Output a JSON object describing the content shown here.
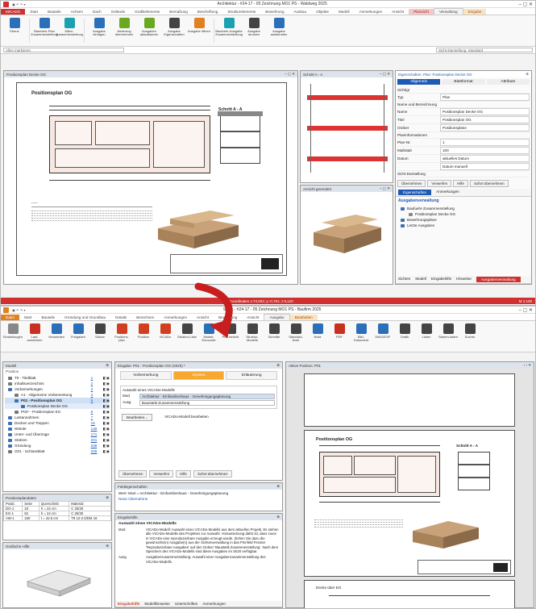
{
  "top": {
    "title": "Architektur - #24-17 - 05 Zeichnung MO1 PS - Waldweg 2025",
    "tabs": [
      "MICADO",
      "Start",
      "Bauteile",
      "Achsen",
      "Dach",
      "Gelände",
      "Grafikelemente",
      "Bemaßung",
      "Beschriftung",
      "Strukturelemente",
      "Bewehrung",
      "Ausbau",
      "Objekte",
      "Modell",
      "Anmerkungen",
      "Ansicht",
      "Plansicht",
      "Verwaltung",
      "Eingabe"
    ],
    "ribbon": [
      {
        "label": "Ebene"
      },
      {
        "label": "Baufuehr-Plan Zusammenstellung"
      },
      {
        "label": "Mikro-Zusammenstellung"
      },
      {
        "label": "Ausgabe einfügen"
      },
      {
        "label": "Änderung übernehmen"
      },
      {
        "label": "Ausgaben aktualisieren"
      },
      {
        "label": "Ausgabe Eigenschaften"
      },
      {
        "label": "Ausgabe öffnen"
      },
      {
        "label": "Baufuehr-Ausgabe Zusammenstellung"
      },
      {
        "label": "Ausgabe drucken"
      },
      {
        "label": "Ausgabe ausblenden"
      }
    ],
    "filter_placeholder": "Alles markieren",
    "filter_right": "Sicht-Darstellung: Standard",
    "drawing_title": "Positionsplan Decke OG",
    "plan_heading": "Positionsplan OG",
    "section_label": "Schnitt A - A",
    "section_window": "Schnitt A - A",
    "iso_window": "Ansicht gerendert",
    "props": {
      "title": "Eigenschaften: Plan: Positionsplan Decke OG",
      "tabs": [
        "Allgemein",
        "Blattformat",
        "Attribute"
      ],
      "rows": [
        {
          "k": "Sichtigr",
          "v": ""
        },
        {
          "k": "Typ",
          "v": "Plan"
        },
        {
          "k": "Name und Bezeichnung",
          "v": ""
        },
        {
          "k": "Name",
          "v": "Positionsplan Decke OG"
        },
        {
          "k": "Titel",
          "v": "Positionsplan OG"
        },
        {
          "k": "Ordner",
          "v": "Positionspläne"
        },
        {
          "k": "Planinformationen",
          "v": ""
        },
        {
          "k": "Plan-Nr.",
          "v": "1"
        },
        {
          "k": "Maßstab",
          "v": "100"
        },
        {
          "k": "Datum",
          "v": "aktuelles Datum"
        },
        {
          "k": "",
          "v": "Datum manuell"
        },
        {
          "k": "Sicht-Darstellung",
          "v": ""
        }
      ],
      "buttons": [
        "Übernehmen",
        "Verwerfen",
        "Hilfe",
        "Sofort übernehmen"
      ],
      "subtabs": [
        "Eigenschaften",
        "Anmerkungen"
      ],
      "ausgabe_title": "Ausgabenverwaltung",
      "tree": [
        "Baufuehr-Zusammenstellung",
        "Positionsplan Decke OG",
        "Bewehrungspläne",
        "Letzte Ausgaben"
      ],
      "bottom_tabs": [
        "Sichten",
        "Modell",
        "Eingabehilfe",
        "Hinweise",
        "Ausgabenverwaltung"
      ]
    },
    "status": "Koordinaten x:74,002; y:-0,761; z:0,120",
    "status_right": "M 1:100"
  },
  "bottom": {
    "title": "Statik - #24-17 - 05 Zeichnung MO1 PS - Baufirm 2025",
    "tabs": [
      "Datei",
      "Start",
      "Bauteile",
      "Gründung und Grundbau",
      "Details",
      "Berechnen",
      "Anmerkungen",
      "Ansicht",
      "Bewehrung",
      "Ansicht",
      "Ausgabe",
      "Bearbeiten"
    ],
    "ribbon": [
      "Einstellungen",
      "Last-annahmen",
      "Verwenden",
      "Freigaben",
      "Skizze",
      "Positions-plan",
      "Position",
      "VICADo",
      "Struktur-Liste",
      "Modell-Eurocode",
      "Prüf-bericht",
      "Struktur-Modelle",
      "Schnitte",
      "Standard-texte",
      "Notiz",
      "PDF",
      "Bild-Dokument",
      "DWG/DXF",
      "Grafik",
      "Listen",
      "Stamm-daten",
      "Sucher"
    ],
    "model": {
      "title": "Modell",
      "header": "Position",
      "items": [
        {
          "label": "T0 - Titelblatt",
          "n": "1"
        },
        {
          "label": "Inhaltsverzeichnis",
          "n": "2"
        },
        {
          "label": "Vorbemerkungen",
          "n": "3"
        },
        {
          "label": "A1 - Allgemeine Vorbemerkung",
          "n": "4"
        },
        {
          "label": "P01 - Positionsplan OG",
          "n": "5"
        },
        {
          "label": "Positionsplan Decke OG",
          "n": ""
        },
        {
          "label": "P02* - Positionsplan EG",
          "n": "6"
        },
        {
          "label": "Lastannahmen",
          "n": "7"
        },
        {
          "label": "Decken und Treppen",
          "n": "15"
        },
        {
          "label": "Wände",
          "n": "149"
        },
        {
          "label": "Unter- und Überzüge",
          "n": "171"
        },
        {
          "label": "Stützen",
          "n": "201"
        },
        {
          "label": "Gründung",
          "n": "208"
        },
        {
          "label": "G01 - Schlussblatt",
          "n": "209"
        }
      ]
    },
    "posplan": {
      "title": "Positionsplandaten",
      "headers": [
        "Positi.",
        "Seite",
        "Querschnitt",
        "Material"
      ],
      "rows": [
        [
          "DG-1",
          "18",
          "h = 22 cm",
          "C 25/30"
        ],
        [
          "EG-1",
          "62",
          "h = 24 cm",
          "C 25/30"
        ],
        [
          "AW-1",
          "150",
          "t = 42.5 cm",
          "T8 12-2.0/DM 16"
        ]
      ]
    },
    "grafik_title": "Grafische Hilfe",
    "eingabe": {
      "title": "Eingabe: P01 - Positionsplan OG (S020) *",
      "tabs": [
        "Vorbemerkung",
        "System",
        "Erläuterung"
      ],
      "group": "Auswahl eines VICADo-Modells",
      "rows": [
        {
          "k": "Mod",
          "v": "Architektur - Einfamilienhaus - Genehmigungsplanung"
        },
        {
          "k": "Ausg",
          "v": "Baustatik-Zusammenstellung"
        }
      ],
      "btn1": "Bearbeiten...",
      "btn2": "VICADo-Modell bearbeiten",
      "buttons": [
        "Übernehmen",
        "Verwerfen",
        "Hilfe",
        "Sofort übernehmen"
      ]
    },
    "feld": {
      "title": "Feldeigenschaften",
      "text1": "Wert: Mod = Architektur - Einfamilienhaus - Genehmigungsplanung",
      "text2": "Neue Übernahme"
    },
    "hilfe": {
      "title": "Eingabehilfe",
      "heading": "Auswahl eines VICADo-Modells",
      "mod_k": "Mod",
      "mod_v": "VICADo-Modell: Auswahl eines VICADo-Modells aus dem aktuellen Projekt. Es stehen alle VICADo-Modelle des Projektes zur Auswahl. Voraussetzung dafür ist, dass zuvor in VICADo eine reproduzierbare Ausgabe erzeugt wurde. Ziehen Sie dazu die gewünschte(n) Ausgabe(n) aus der Sichtenverwaltung in das Pinnfeld Fenster 'Reproduzierbare Ausgaben' auf den Ordner 'Baustatik Zusammenstellung'. Nach dem Speichern des VICADo-Modells sind diese Ausgaben im S020 verfügbar.",
      "ausg_k": "Ausg",
      "ausg_v": "Ausgabenzusammenstellung: Auswahl einer Ausgabenzusammenstellung des VICADo-Modells.",
      "tabs": [
        "Eingabehilfe",
        "Modellhinweise",
        "Unterschriften",
        "Anmerkungen"
      ]
    },
    "preview": {
      "title": "Aktive Position: P01",
      "plan_heading": "Positionsplan OG",
      "section_label": "Schnitt A - A",
      "next_label": "Decke über EG"
    }
  }
}
